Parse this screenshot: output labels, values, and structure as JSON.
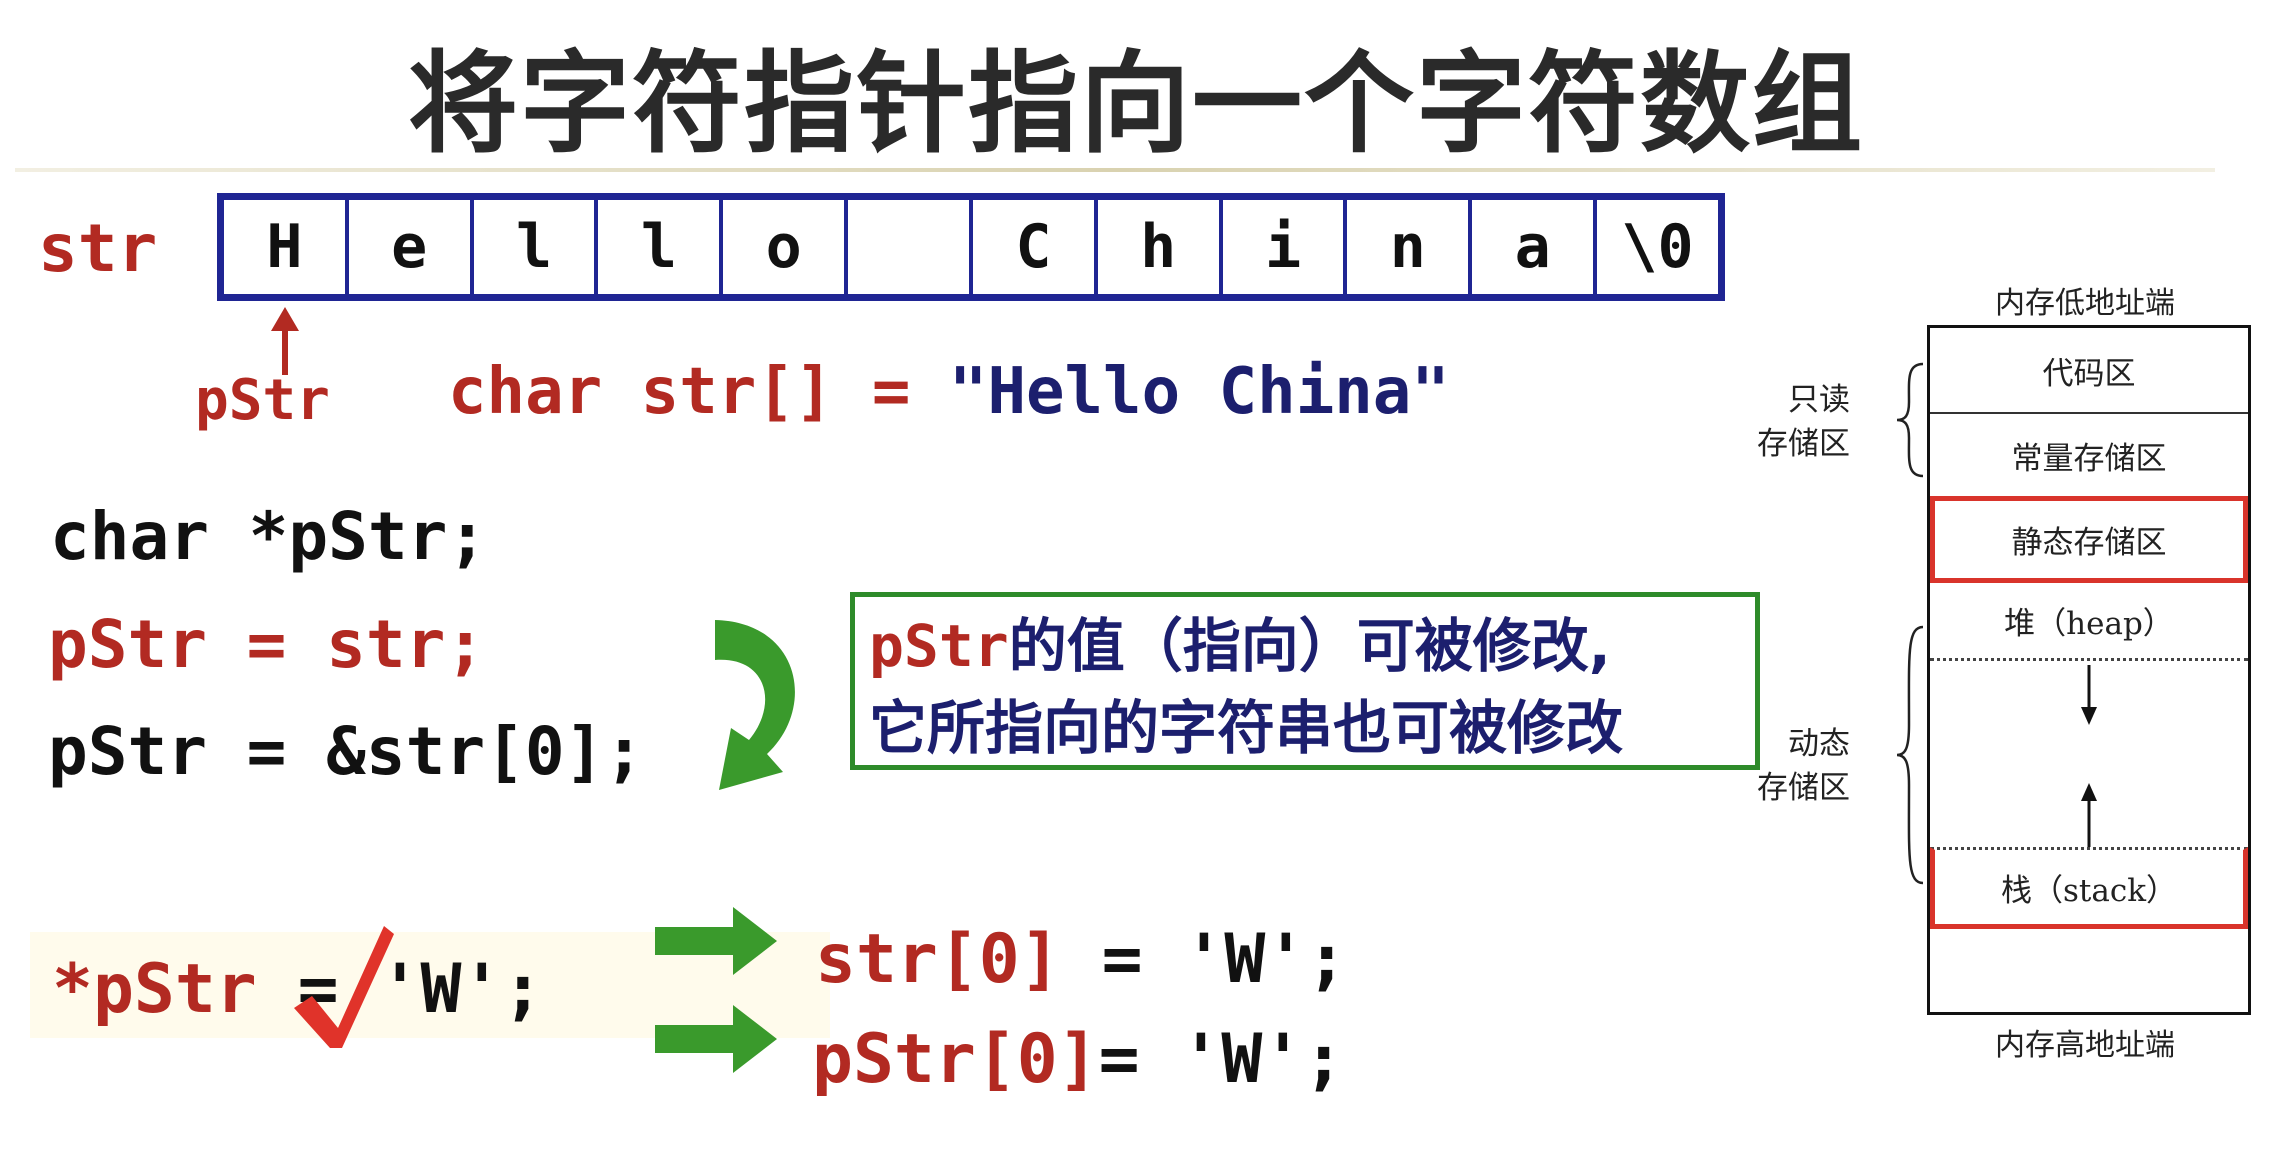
{
  "title": "将字符指针指向一个字符数组",
  "array": {
    "label": "str",
    "cells": [
      "H",
      "e",
      "l",
      "l",
      "o",
      "",
      "C",
      "h",
      "i",
      "n",
      "a",
      "\\0"
    ]
  },
  "pointer_label": "pStr",
  "declaration": {
    "prefix": "char str[] = ",
    "literal": "\"Hello China\""
  },
  "code": {
    "line1": "char *pStr;",
    "line2": "pStr = str;",
    "line3_a": "pStr = ",
    "line3_b": "&str[0];"
  },
  "note": {
    "line1_code": "pStr",
    "line1_text": "的值（指向）可被修改,",
    "line2_text": "它所指向的字符串也可被修改"
  },
  "assignment": {
    "lhs": "*pStr",
    "op": " = ",
    "value": "'W';",
    "equiv1_lhs": "str[0]",
    "equiv1_rest": " = 'W';",
    "equiv2_lhs": "pStr[0]",
    "equiv2_rest": "= 'W';"
  },
  "memory": {
    "top_label": "内存低地址端",
    "bottom_label": "内存高地址端",
    "segments": {
      "code": "代码区",
      "const": "常量存储区",
      "static": "静态存储区",
      "heap": "堆（heap）",
      "stack": "栈（stack）"
    },
    "readonly_label_1": "只读",
    "readonly_label_2": "存储区",
    "dynamic_label_1": "动态",
    "dynamic_label_2": "存储区"
  },
  "colors": {
    "red": "#b22a22",
    "navy": "#1c1f6e",
    "array_border": "#1f2593",
    "green": "#3a9a2c",
    "highlight_border": "#d9342b"
  }
}
